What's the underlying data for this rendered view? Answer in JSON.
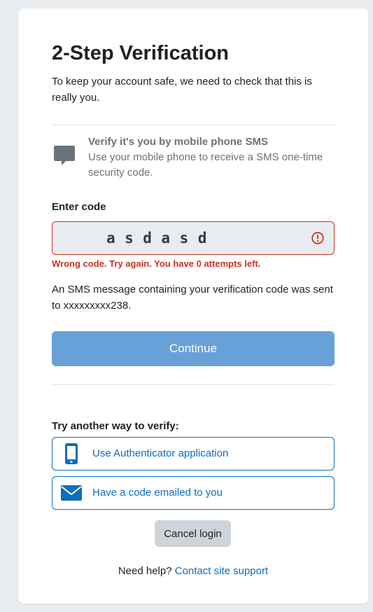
{
  "page": {
    "title": "2-Step Verification",
    "intro": "To keep your account safe, we need to check that this is really you."
  },
  "method": {
    "icon": "chat-bubble-icon",
    "title": "Verify it's you by mobile phone SMS",
    "description": "Use your mobile phone to receive a SMS one-time security code."
  },
  "code_field": {
    "label": "Enter code",
    "value": "asdasd",
    "error_icon": "exclamation-circle-icon",
    "error": "Wrong code. Try again. You have 0 attempts left."
  },
  "sms_note": "An SMS message containing your verification code was sent to xxxxxxxxx238.",
  "continue_label": "Continue",
  "alternatives": {
    "heading": "Try another way to verify:",
    "options": [
      {
        "icon": "mobile-phone-icon",
        "label": "Use Authenticator application"
      },
      {
        "icon": "envelope-icon",
        "label": "Have a code emailed to you"
      }
    ]
  },
  "cancel_label": "Cancel login",
  "help": {
    "prefix": "Need help?",
    "link": "Contact site support"
  },
  "colors": {
    "primary": "#0f6cbf",
    "primary_disabled": "#68a1d7",
    "error": "#ca3120",
    "muted": "#6a737b"
  }
}
